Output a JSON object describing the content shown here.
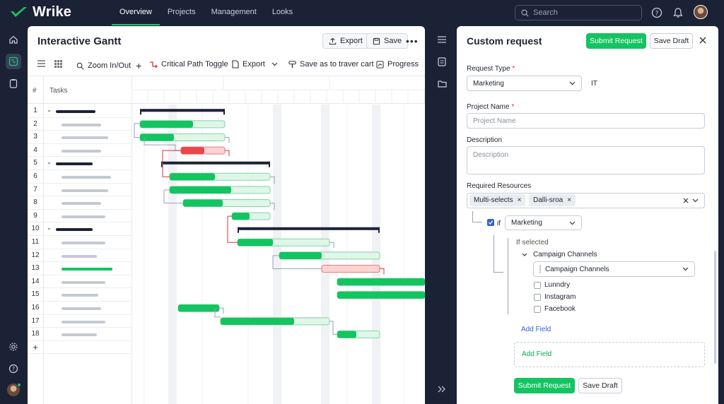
{
  "app": {
    "name": "Wrike"
  },
  "nav": {
    "tabs": [
      {
        "label": "Overview",
        "active": true
      },
      {
        "label": "Projects",
        "active": false
      },
      {
        "label": "Management",
        "active": false
      },
      {
        "label": "Looks",
        "active": false
      }
    ]
  },
  "search": {
    "placeholder": "Search"
  },
  "colors": {
    "brand": "#13c461",
    "navy": "#1b2236",
    "critical": "#f05a5a",
    "link": "#2f64d6"
  },
  "left_rail": {
    "icons": [
      "home-icon",
      "gantt-icon",
      "clipboard-icon",
      "settings-icon",
      "help-icon",
      "avatar"
    ]
  },
  "gantt": {
    "title": "Interactive Gantt",
    "export_label": "Export",
    "save_label": "Save",
    "toolbar": {
      "zoom_label": "Zoom In/Out",
      "critical_path_label": "Critical Path Toggle",
      "export_label": "Export",
      "save_as_label": "Save as to traver cart",
      "progress_label": "Progress"
    },
    "columns": {
      "number": "#",
      "tasks": "Tasks"
    },
    "rows": [
      "1",
      "2",
      "3",
      "4",
      "5",
      "6",
      "7",
      "8",
      "9",
      "10",
      "11",
      "12",
      "13",
      "14",
      "15",
      "16",
      "17",
      "18"
    ],
    "add_row": "+"
  },
  "sidebar_mini": {
    "icons": [
      "list-icon",
      "document-icon",
      "folder-icon",
      "collapse-icon"
    ]
  },
  "request": {
    "title": "Custom request",
    "submit_label": "Submit Request",
    "save_draft_label": "Save Draft",
    "request_type": {
      "label": "Request Type",
      "value": "Marketing",
      "suffix": "IT"
    },
    "project_name": {
      "label": "Project Name",
      "placeholder": "Project Name"
    },
    "description": {
      "label": "Description",
      "placeholder": "Description"
    },
    "resources": {
      "label": "Required Resources",
      "chips": [
        "Multi-selects",
        "Dalli-sroa"
      ]
    },
    "condition": {
      "if_label": "if",
      "value": "Marketing"
    },
    "if_selected": {
      "label": "If selected",
      "group_label": "Campaign Channels",
      "select_value": "Campaign Channels",
      "options": [
        "Lunndry",
        "Instagram",
        "Facebook"
      ]
    },
    "add_field_1": "Add Field",
    "add_field_2": "Add Field",
    "footer_submit": "Submit Request",
    "footer_draft": "Save Draft"
  }
}
